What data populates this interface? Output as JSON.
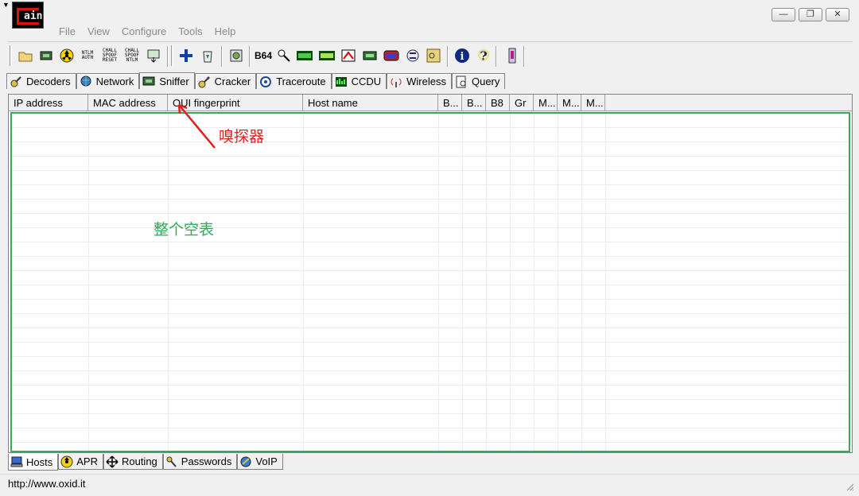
{
  "window": {
    "logo_text": "ain",
    "minimize": "—",
    "maximize": "❐",
    "close": "✕"
  },
  "menu": [
    "File",
    "View",
    "Configure",
    "Tools",
    "Help"
  ],
  "toolbar": {
    "ntlm_auth": "NTLM AUTH",
    "chall_spoof_reset": "CHALL SPOOF RESET",
    "chall_spoof_ntlm": "CHALL SPOOF NTLM",
    "b64": "B64"
  },
  "top_tabs": [
    "Decoders",
    "Network",
    "Sniffer",
    "Cracker",
    "Traceroute",
    "CCDU",
    "Wireless",
    "Query"
  ],
  "active_top_tab": "Sniffer",
  "columns": [
    "IP address",
    "MAC address",
    "OUI fingerprint",
    "Host name",
    "B...",
    "B...",
    "B8",
    "Gr",
    "M...",
    "M...",
    "M..."
  ],
  "annotations": {
    "sniffer": "嗅探器",
    "table": "整个空表"
  },
  "bottom_tabs": [
    "Hosts",
    "APR",
    "Routing",
    "Passwords",
    "VoIP"
  ],
  "active_bottom_tab": "Hosts",
  "status": {
    "url": "http://www.oxid.it"
  },
  "colors": {
    "annotation_red": "#e02020",
    "annotation_green": "#2ea855",
    "table_border": "#3aaa5a"
  }
}
